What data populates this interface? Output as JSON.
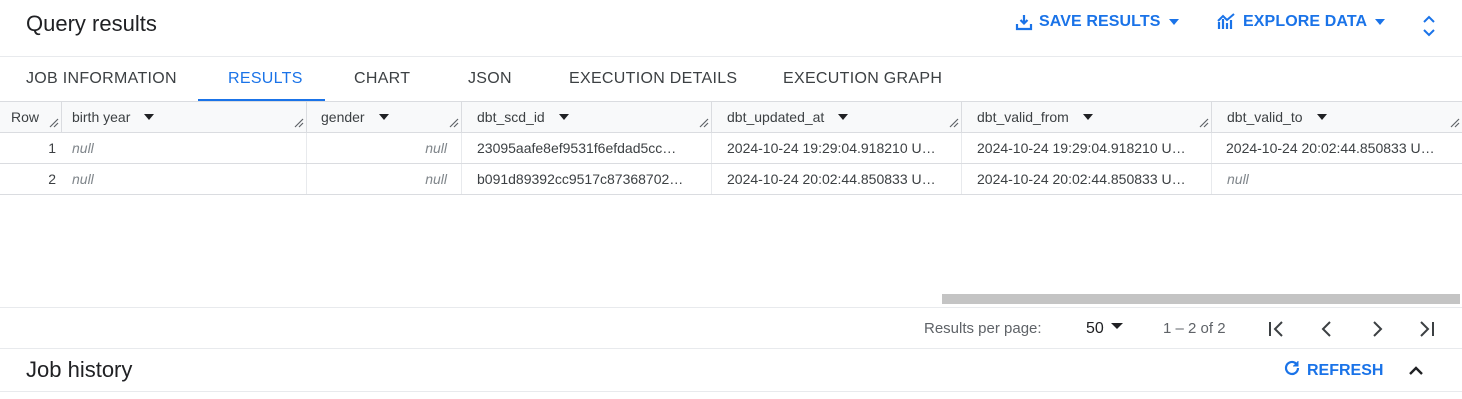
{
  "header": {
    "title": "Query results",
    "save_results_label": "SAVE RESULTS",
    "explore_data_label": "EXPLORE DATA"
  },
  "tabs": [
    {
      "label": "JOB INFORMATION",
      "active": false
    },
    {
      "label": "RESULTS",
      "active": true
    },
    {
      "label": "CHART",
      "active": false
    },
    {
      "label": "JSON",
      "active": false
    },
    {
      "label": "EXECUTION DETAILS",
      "active": false
    },
    {
      "label": "EXECUTION GRAPH",
      "active": false
    }
  ],
  "table": {
    "columns": [
      "Row",
      "birth year",
      "gender",
      "dbt_scd_id",
      "dbt_updated_at",
      "dbt_valid_from",
      "dbt_valid_to"
    ],
    "rows": [
      {
        "row": "1",
        "birth_year": "null",
        "gender": "null",
        "dbt_scd_id": "23095aafe8ef9531f6efdad5cc…",
        "dbt_updated_at": "2024-10-24 19:29:04.918210 U…",
        "dbt_valid_from": "2024-10-24 19:29:04.918210 U…",
        "dbt_valid_to": "2024-10-24 20:02:44.850833 U…"
      },
      {
        "row": "2",
        "birth_year": "null",
        "gender": "null",
        "dbt_scd_id": "b091d89392cc9517c87368702…",
        "dbt_updated_at": "2024-10-24 20:02:44.850833 U…",
        "dbt_valid_from": "2024-10-24 20:02:44.850833 U…",
        "dbt_valid_to": "null"
      }
    ]
  },
  "pager": {
    "results_per_page_label": "Results per page:",
    "page_size": "50",
    "range": "1 – 2 of 2"
  },
  "job_history": {
    "title": "Job history",
    "refresh_label": "REFRESH"
  },
  "colors": {
    "accent": "#1a73e8",
    "text": "#202124",
    "muted": "#5f6368",
    "border": "#dadce0"
  },
  "icons": [
    "download-icon",
    "chevron-down-icon",
    "explore-chart-icon",
    "expand-collapse-icon",
    "sort-arrow-icon",
    "column-resize-icon",
    "first-page-icon",
    "previous-page-icon",
    "next-page-icon",
    "last-page-icon",
    "refresh-icon",
    "chevron-up-icon"
  ]
}
